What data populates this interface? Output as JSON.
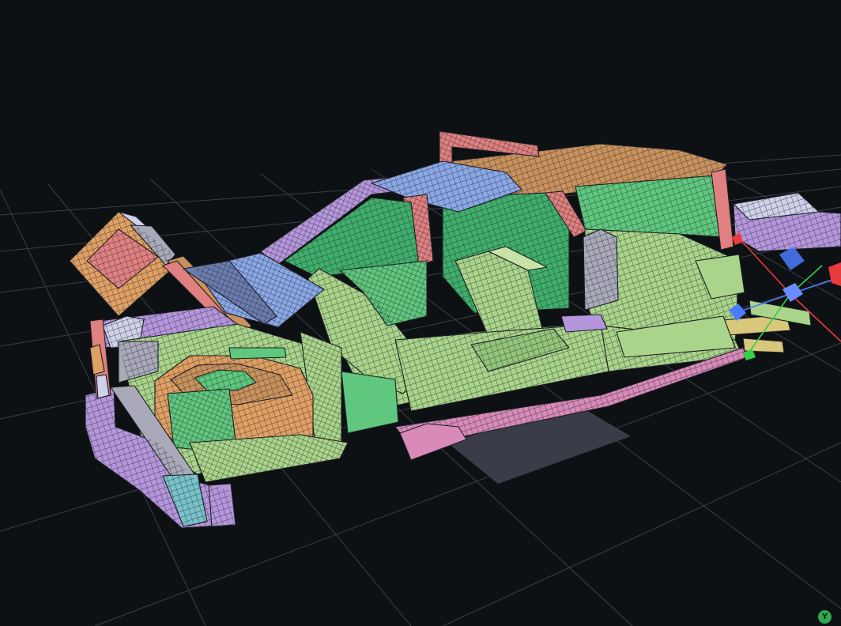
{
  "viewport": {
    "background": "#0e1114",
    "grid_color": "#3a3f46",
    "ground_shadow_color": "#3a3d48"
  },
  "model": {
    "part_colors": {
      "green_light": "#a9d48a",
      "green_mid": "#5fc77e",
      "green_dark": "#3fae6a",
      "orange": "#e0a063",
      "brown": "#c9915c",
      "pink": "#e08080",
      "blue": "#8aa7e6",
      "purple": "#b596dc",
      "grey": "#a9a9b9",
      "pale_blue": "#cfd2ea",
      "teal": "#79c2c9",
      "yellow": "#d9c77c",
      "magenta": "#d88ab8"
    }
  },
  "gizmo": {
    "x_color": "#e83b3b",
    "y_color": "#33d14a",
    "z_color": "#4a7cff",
    "icon": "transform-gizmo-icon"
  },
  "axis_indicator": {
    "label": "Y",
    "color": "#2fa84f",
    "icon": "axis-indicator-icon"
  }
}
